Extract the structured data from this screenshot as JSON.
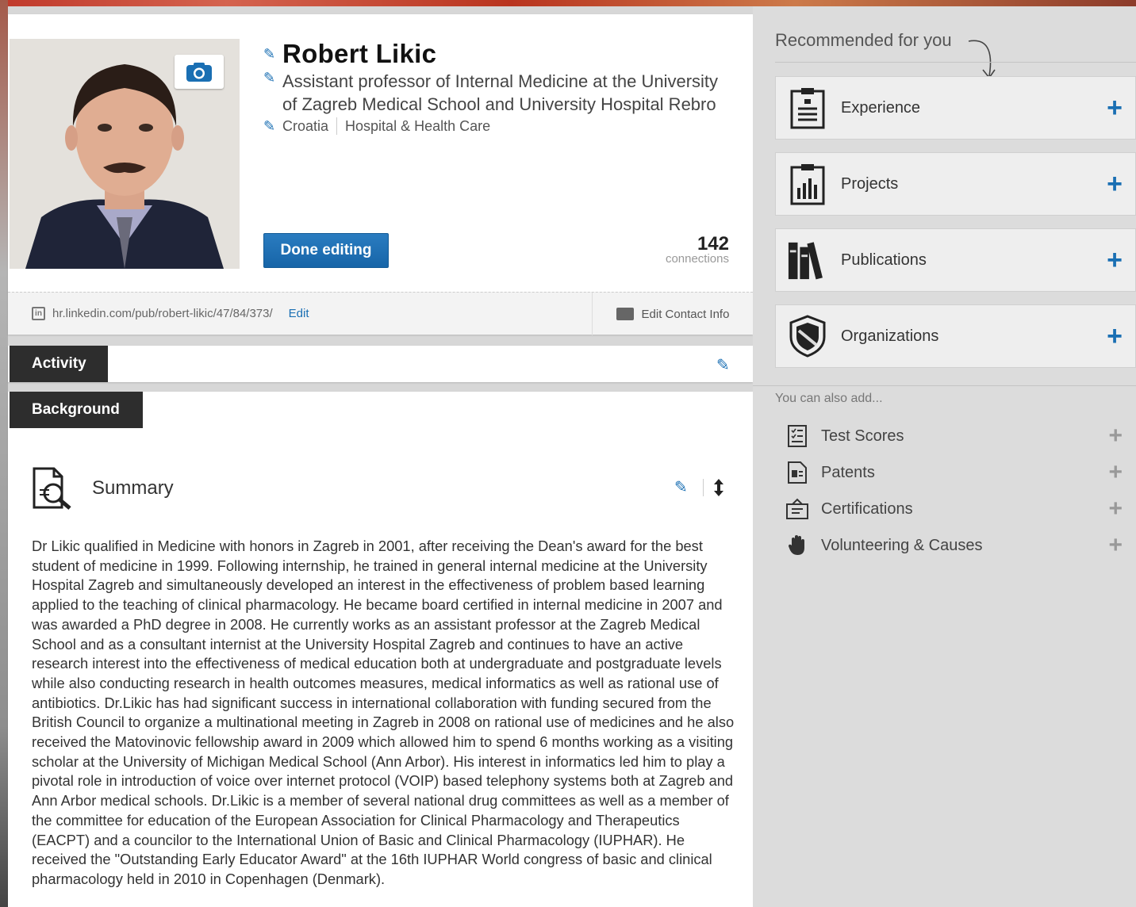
{
  "profile": {
    "name": "Robert Likic",
    "headline": "Assistant professor of Internal Medicine at the University of Zagreb Medical School and University Hospital Rebro",
    "location": "Croatia",
    "industry": "Hospital & Health Care",
    "done_editing_label": "Done editing",
    "connections_count": "142",
    "connections_label": "connections",
    "public_url": "hr.linkedin.com/pub/robert-likic/47/84/373/",
    "url_edit_label": "Edit",
    "edit_contact_label": "Edit Contact Info"
  },
  "sections": {
    "activity_label": "Activity",
    "background_label": "Background",
    "summary_title": "Summary",
    "summary_text": "Dr Likic qualified in Medicine with honors in Zagreb in 2001, after receiving the Dean's award for the best student of medicine in 1999. Following internship, he trained in general internal medicine at the University Hospital Zagreb and simultaneously developed an interest in the effectiveness of problem based learning applied to the teaching of clinical pharmacology. He became board certified in internal medicine in 2007 and was awarded a PhD degree in 2008. He currently works as an assistant professor at the Zagreb Medical School and as a consultant internist at the University Hospital Zagreb and continues to have an active research interest into the effectiveness of medical education both at undergraduate and postgraduate levels while also conducting research in health outcomes measures, medical informatics as well as rational use of antibiotics. Dr.Likic has had significant success in international collaboration with funding secured from the British Council to organize a multinational meeting in Zagreb in 2008 on rational use of medicines and he also received the Matovinovic fellowship award in 2009 which allowed him to spend 6 months working as a visiting scholar at the University of Michigan Medical School (Ann Arbor). His interest in informatics led him to play a pivotal role in introduction of voice over internet protocol (VOIP) based telephony systems both at Zagreb and Ann Arbor medical schools. Dr.Likic is a member of several national drug committees as well as a member of the committee for education of the European Association for Clinical Pharmacology and Therapeutics (EACPT) and a councilor to the International Union of Basic and Clinical Pharmacology (IUPHAR). He received the \"Outstanding Early Educator Award\" at the 16th IUPHAR World congress of basic and clinical pharmacology held in 2010 in Copenhagen (Denmark)."
  },
  "recommended": {
    "title": "Recommended for you",
    "items": [
      {
        "label": "Experience",
        "icon": "experience-icon"
      },
      {
        "label": "Projects",
        "icon": "projects-icon"
      },
      {
        "label": "Publications",
        "icon": "publications-icon"
      },
      {
        "label": "Organizations",
        "icon": "organizations-icon"
      }
    ]
  },
  "also_add": {
    "title": "You can also add...",
    "items": [
      {
        "label": "Test Scores",
        "icon": "test-scores-icon"
      },
      {
        "label": "Patents",
        "icon": "patents-icon"
      },
      {
        "label": "Certifications",
        "icon": "certifications-icon"
      },
      {
        "label": "Volunteering & Causes",
        "icon": "volunteering-icon"
      }
    ]
  },
  "colors": {
    "accent": "#1a6fb3",
    "tab_dark": "#2d2d2d",
    "sidebar_bg": "#dcdcdc"
  }
}
